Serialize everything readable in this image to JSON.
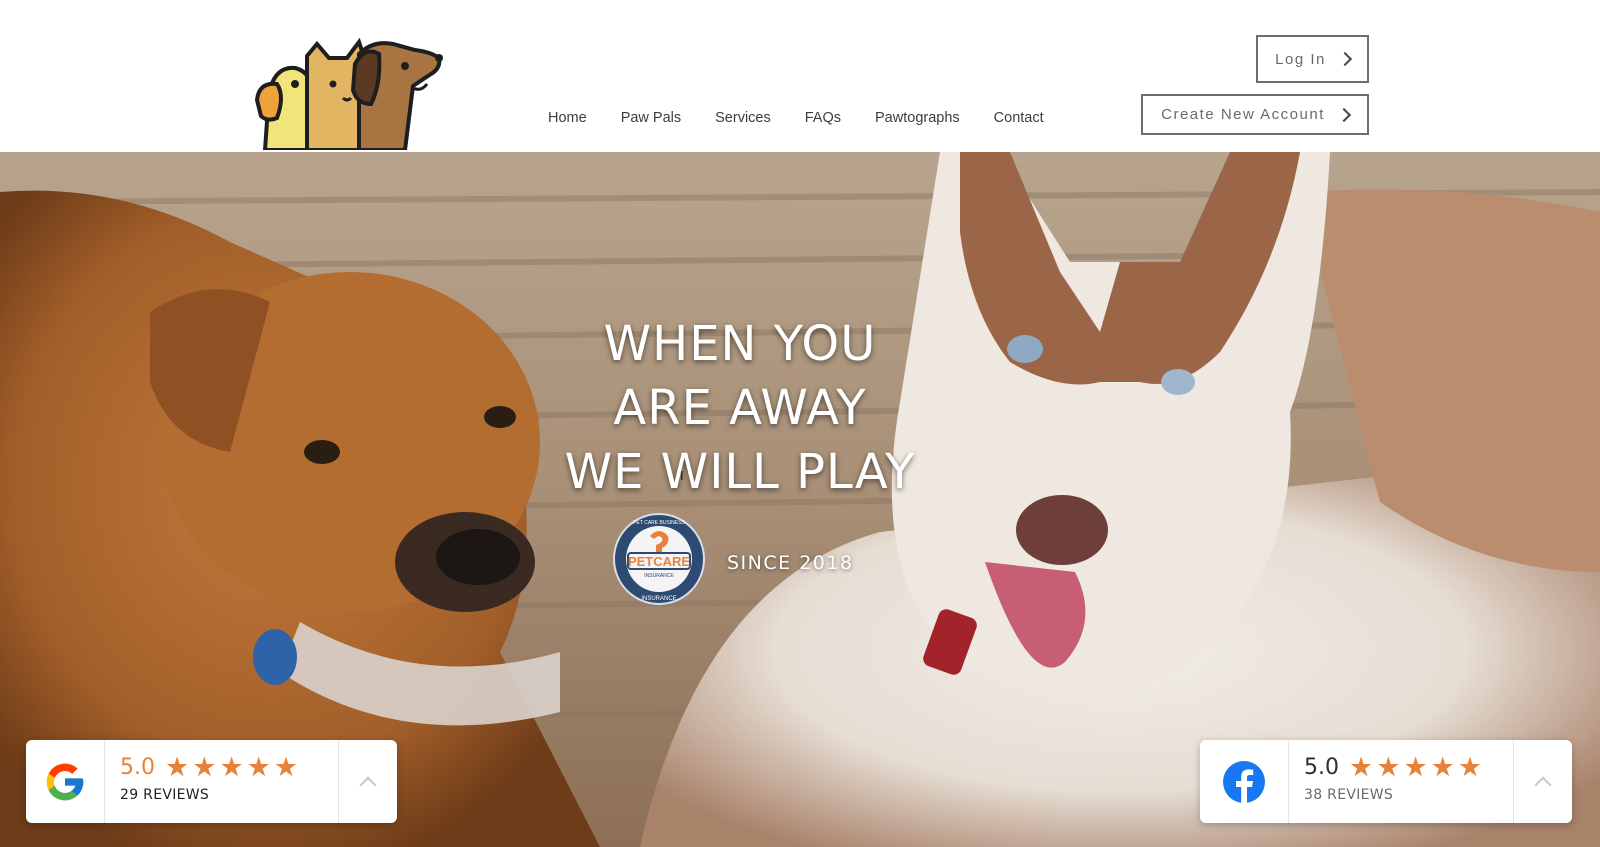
{
  "header": {
    "logo_icon": "pets-logo-icon",
    "nav": [
      "Home",
      "Paw Pals",
      "Services",
      "FAQs",
      "Pawtographs",
      "Contact"
    ],
    "login_label": "Log In",
    "create_account_label": "Create New Account"
  },
  "hero": {
    "headline_lines": [
      "WHEN YOU",
      "ARE AWAY",
      "WE WILL PLAY"
    ],
    "badge": {
      "top_text": "PET CARE BUSINESS",
      "center_text": "PETCARE",
      "sub_text": "INSURANCE",
      "bottom_text": "INSURANCE"
    },
    "since_label": "SINCE 2018"
  },
  "reviews": {
    "google": {
      "icon": "google-icon",
      "score": "5.0",
      "stars": 5,
      "count_label": "29 REVIEWS"
    },
    "facebook": {
      "icon": "facebook-icon",
      "score": "5.0",
      "stars": 5,
      "count_label": "38 REVIEWS"
    }
  },
  "colors": {
    "accent_orange": "#e8823a",
    "button_border": "#6e6e6e",
    "nav_text": "#3d3d3d",
    "facebook_blue": "#1877f2"
  }
}
